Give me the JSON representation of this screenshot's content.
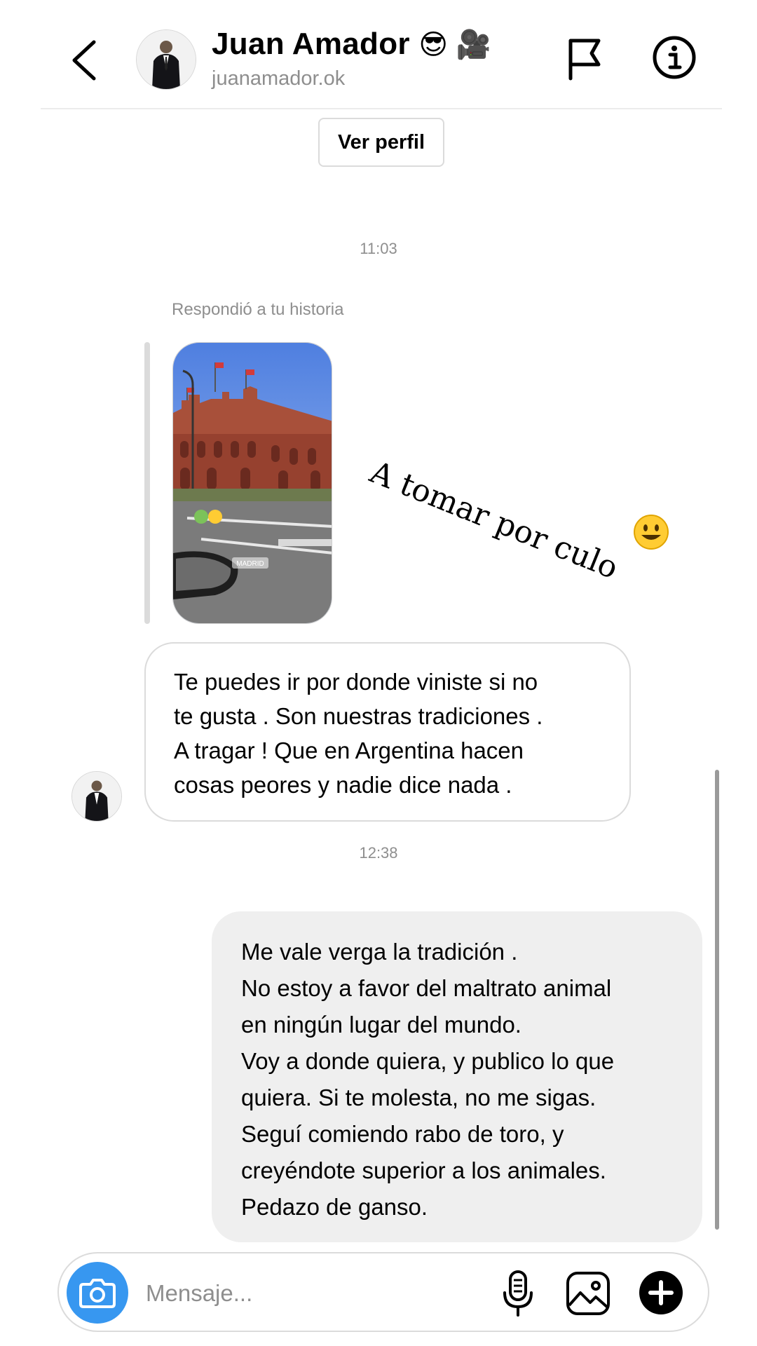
{
  "header": {
    "name": "Juan Amador",
    "name_emojis": "😎 🎥",
    "username": "juanamador.ok"
  },
  "view_profile_label": "Ver perfil",
  "conversation": {
    "timestamp_1": "11:03",
    "replied_label": "Respondió a tu historia",
    "story": {
      "caption": "A tomar por culo",
      "caption_emoji": "😃",
      "sticker_emojis": "🤢🥺",
      "location_tag": "MADRID"
    },
    "incoming_message": {
      "lines": [
        "Te puedes ir por donde viniste si no",
        "te gusta . Son nuestras tradiciones .",
        "A tragar ! Que en Argentina hacen",
        "cosas peores y nadie dice nada ."
      ]
    },
    "timestamp_2": "12:38",
    "outgoing_message": {
      "lines": [
        "Me vale verga la tradición .",
        "No estoy a favor del maltrato animal",
        "en ningún lugar del mundo.",
        "Voy a donde quiera, y publico lo que",
        "quiera. Si te molesta, no me sigas.",
        "Seguí comiendo rabo de toro, y",
        "creyéndote superior a los animales.",
        "Pedazo de ganso."
      ]
    }
  },
  "composer": {
    "placeholder": "Mensaje..."
  },
  "icons": {
    "back": "chevron-left-icon",
    "flag": "flag-icon",
    "info": "info-icon",
    "camera": "camera-icon",
    "mic": "microphone-icon",
    "gallery": "gallery-icon",
    "plus": "plus-circle-icon"
  },
  "colors": {
    "accent": "#3797f0",
    "outgoing_bubble": "#efefef",
    "border": "#dbdbdb",
    "muted_text": "#8e8e8e"
  }
}
